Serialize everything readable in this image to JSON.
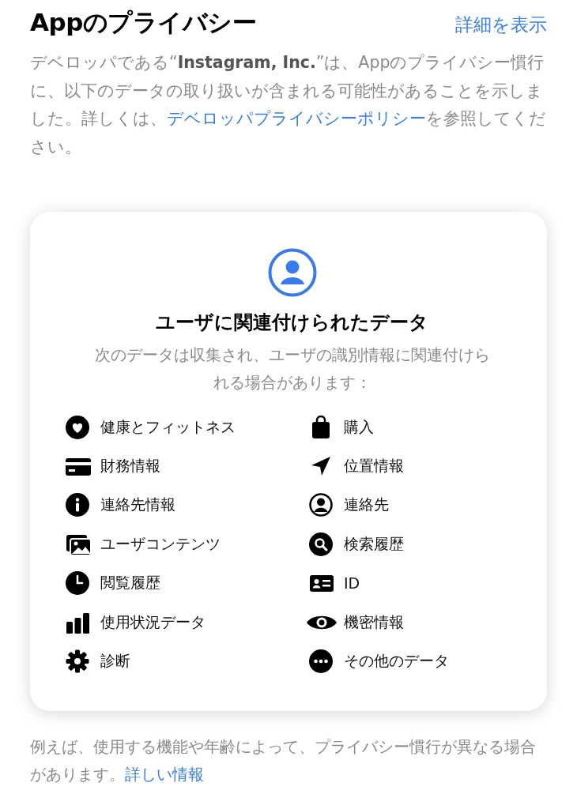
{
  "header": {
    "title": "Appのプライバシー",
    "link": "詳細を表示"
  },
  "description": {
    "text": "デベロッパである“**Instagram, Inc.**”は、Appのプライバシー慣行に、以下のデータの取り扱いが含まれる可能性があることを示しました。詳しくは、",
    "link": "デベロッパプライバシーポリシー",
    "text_after": "を参照してください。"
  },
  "card": {
    "title": "ユーザに関連付けられたデータ",
    "subtitle": "次のデータは収集され、ユーザの識別情報に関連付けられる場合があります：",
    "items": [
      {
        "label": "健康とフィットネス"
      },
      {
        "label": "購入"
      },
      {
        "label": "財務情報"
      },
      {
        "label": "位置情報"
      },
      {
        "label": "連絡先情報"
      },
      {
        "label": "連絡先"
      },
      {
        "label": "ユーザコンテンツ"
      },
      {
        "label": "検索履歴"
      },
      {
        "label": "閲覧履歴"
      },
      {
        "label": "ID"
      },
      {
        "label": "使用状況データ"
      },
      {
        "label": "機密情報"
      },
      {
        "label": "診断"
      },
      {
        "label": "その他のデータ"
      }
    ]
  },
  "footer": {
    "text": "例えば、使用する機能や年齢によって、プライバシー慣行が異なる場合があります。",
    "link": "詳しい情報"
  }
}
